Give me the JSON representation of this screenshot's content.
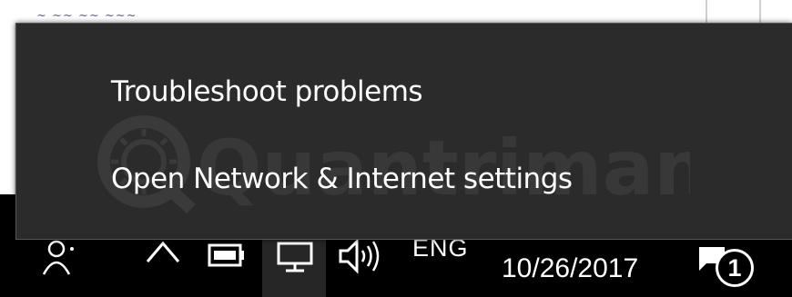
{
  "context_menu": {
    "items": [
      {
        "label": "Troubleshoot problems"
      },
      {
        "label": "Open Network & Internet settings"
      }
    ]
  },
  "taskbar": {
    "language": "ENG",
    "date": "10/26/2017",
    "notification_count": "1",
    "icons": [
      "people-icon",
      "chevron-up-icon",
      "battery-icon",
      "network-icon",
      "volume-icon",
      "action-center-icon"
    ]
  },
  "watermark": {
    "text": "Quantrimang"
  },
  "colors": {
    "menu_bg": "#2b2b2b",
    "taskbar_bg": "#000000",
    "text": "#ffffff"
  }
}
